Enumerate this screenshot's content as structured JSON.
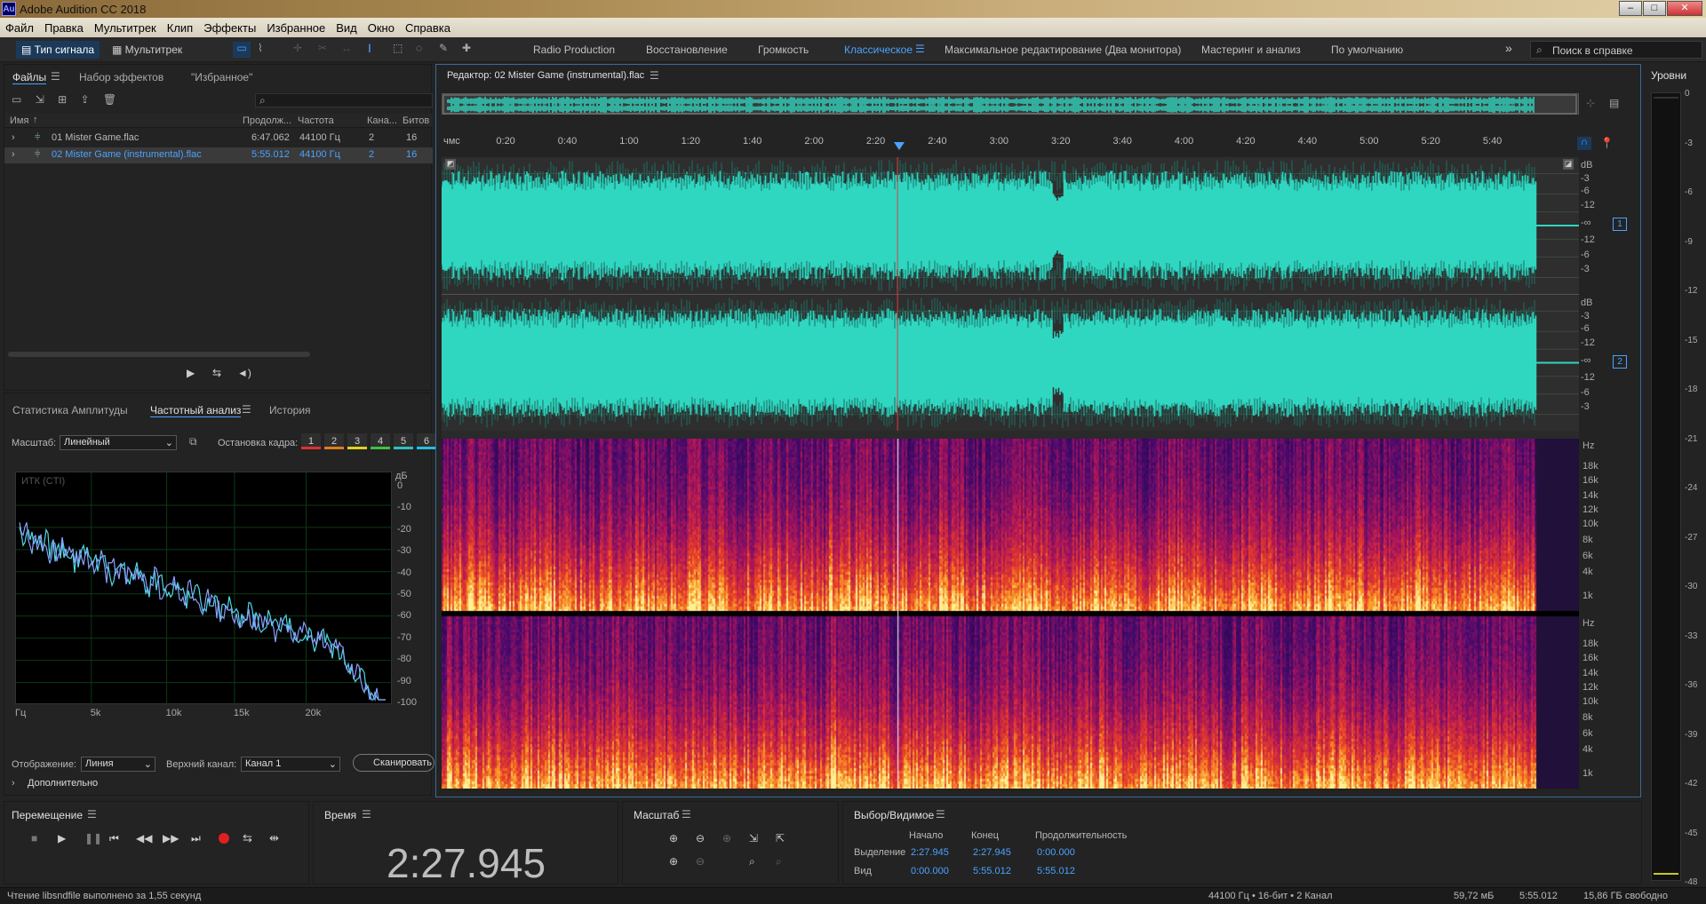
{
  "window": {
    "title": "Adobe Audition CC 2018",
    "app_icon": "Au"
  },
  "menu": [
    "Файл",
    "Правка",
    "Мультитрек",
    "Клип",
    "Эффекты",
    "Избранное",
    "Вид",
    "Окно",
    "Справка"
  ],
  "toolbar": {
    "mode_waveform": "Тип сигнала",
    "mode_multitrack": "Мультитрек",
    "search_placeholder": "Поиск в справке"
  },
  "workspaces": [
    "Radio Production",
    "Восстановление",
    "Громкость",
    "Классическое",
    "Максимальное редактирование (Два монитора)",
    "Мастеринг и анализ",
    "По умолчанию"
  ],
  "active_workspace": "Классическое",
  "files_panel": {
    "tabs": [
      "Файлы",
      "Набор эффектов",
      "\"Избранное\""
    ],
    "columns": [
      "Имя",
      "Продолж...",
      "Частота",
      "Кана...",
      "Битов"
    ],
    "rows": [
      {
        "name": "01 Mister Game.flac",
        "duration": "6:47.062",
        "rate": "44100 Гц",
        "channels": "2",
        "bits": "16",
        "selected": false
      },
      {
        "name": "02 Mister Game (instrumental).flac",
        "duration": "5:55.012",
        "rate": "44100 Гц",
        "channels": "2",
        "bits": "16",
        "selected": true
      }
    ]
  },
  "analysis_panel": {
    "tabs": [
      "Статистика Амплитуды",
      "Частотный анализ",
      "История"
    ],
    "scale_label": "Масштаб:",
    "scale_value": "Линейный",
    "freeze_label": "Остановка кадра:",
    "freeze_slots": [
      "1",
      "2",
      "3",
      "4",
      "5",
      "6"
    ],
    "freeze_colors": [
      "#e03030",
      "#e07a20",
      "#e0d020",
      "#40c040",
      "#30c0c0",
      "#20c0e0"
    ],
    "plot_label": "ИТК (CTI)",
    "y_unit": "дБ",
    "y_ticks": [
      "0",
      "-10",
      "-20",
      "-30",
      "-40",
      "-50",
      "-60",
      "-70",
      "-80",
      "-90",
      "-100"
    ],
    "x_ticks": [
      "Гц",
      "5k",
      "10k",
      "15k",
      "20k"
    ],
    "display_label": "Отображение:",
    "display_value": "Линия",
    "channel_label": "Верхний канал:",
    "channel_value": "Канал 1",
    "scan_button": "Сканировать",
    "advanced_label": "Дополнительно"
  },
  "editor": {
    "title": "Редактор: 02 Mister Game (instrumental).flac",
    "ruler": [
      "чмс",
      "0:20",
      "0:40",
      "1:00",
      "1:20",
      "1:40",
      "2:00",
      "2:20",
      "2:40",
      "3:00",
      "3:20",
      "3:40",
      "4:00",
      "4:20",
      "4:40",
      "5:00",
      "5:20",
      "5:40"
    ],
    "db_labels_ch": [
      "dB",
      "-3",
      "-6",
      "-12",
      "-∞",
      "-12",
      "-6",
      "-3"
    ],
    "hz_labels": [
      "Hz",
      "18k",
      "16k",
      "14k",
      "12k",
      "10k",
      "8k",
      "6k",
      "4k",
      "1k"
    ],
    "channel_badges": [
      "1",
      "2"
    ],
    "playhead_fraction": 0.4165,
    "waveform_color": "#2fd6c0"
  },
  "levels": {
    "title": "Уровни",
    "ticks": [
      "0",
      "-3",
      "-6",
      "-9",
      "-12",
      "-15",
      "-18",
      "-21",
      "-24",
      "-27",
      "-30",
      "-33",
      "-36",
      "-39",
      "-42",
      "-45",
      "-48"
    ]
  },
  "transport": {
    "title": "Перемещение"
  },
  "time_panel": {
    "title": "Время",
    "value": "2:27.945"
  },
  "zoom_panel": {
    "title": "Масштаб"
  },
  "selection_panel": {
    "title": "Выбор/Видимое",
    "headers": [
      "Начало",
      "Конец",
      "Продолжительность"
    ],
    "rows": [
      {
        "label": "Выделение",
        "start": "2:27.945",
        "end": "2:27.945",
        "duration": "0:00.000"
      },
      {
        "label": "Вид",
        "start": "0:00.000",
        "end": "5:55.012",
        "duration": "5:55.012"
      }
    ]
  },
  "status": {
    "message": "Чтение libsndfile выполнено за 1,55 секунд",
    "format": "44100 Гц • 16-бит • 2 Канал",
    "size": "59,72 мБ",
    "duration": "5:55.012",
    "free": "15,86 ГБ свободно"
  }
}
